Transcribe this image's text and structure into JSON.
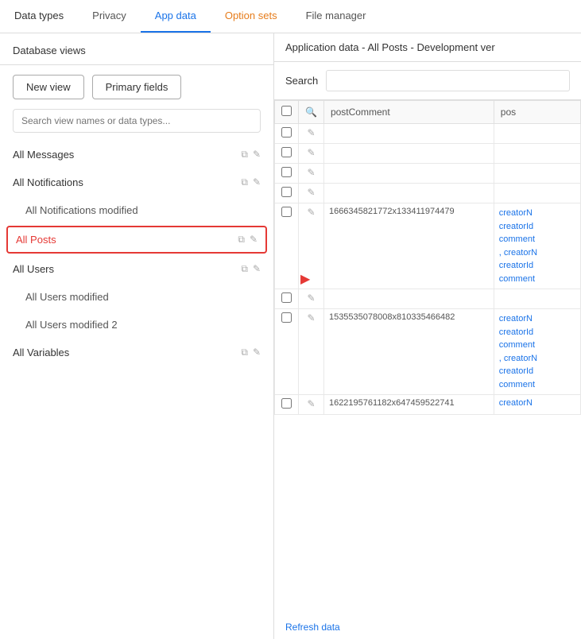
{
  "tabs": [
    {
      "id": "data-types",
      "label": "Data types",
      "active": false,
      "colored": false
    },
    {
      "id": "privacy",
      "label": "Privacy",
      "active": false,
      "colored": false
    },
    {
      "id": "app-data",
      "label": "App data",
      "active": true,
      "colored": false
    },
    {
      "id": "option-sets",
      "label": "Option sets",
      "active": false,
      "colored": true
    },
    {
      "id": "file-manager",
      "label": "File manager",
      "active": false,
      "colored": false
    }
  ],
  "left_panel": {
    "header": "Database views",
    "buttons": {
      "new_view": "New view",
      "primary_fields": "Primary fields"
    },
    "search_placeholder": "Search view names or data types...",
    "nav_items": [
      {
        "id": "all-messages",
        "label": "All Messages",
        "sub": false,
        "selected": false,
        "has_icons": true
      },
      {
        "id": "all-notifications",
        "label": "All Notifications",
        "sub": false,
        "selected": false,
        "has_icons": true
      },
      {
        "id": "all-notifications-modified",
        "label": "All Notifications modified",
        "sub": true,
        "selected": false,
        "has_icons": false
      },
      {
        "id": "all-posts",
        "label": "All Posts",
        "sub": false,
        "selected": true,
        "has_icons": true
      },
      {
        "id": "all-users",
        "label": "All Users",
        "sub": false,
        "selected": false,
        "has_icons": true
      },
      {
        "id": "all-users-modified",
        "label": "All Users modified",
        "sub": true,
        "selected": false,
        "has_icons": false
      },
      {
        "id": "all-users-modified-2",
        "label": "All Users modified 2",
        "sub": true,
        "selected": false,
        "has_icons": false
      },
      {
        "id": "all-variables",
        "label": "All Variables",
        "sub": false,
        "selected": false,
        "has_icons": true
      }
    ]
  },
  "right_panel": {
    "header": "Application data - All Posts - Development ver",
    "search_label": "Search",
    "search_placeholder": "",
    "table": {
      "columns": [
        {
          "id": "check",
          "label": "",
          "type": "check"
        },
        {
          "id": "search",
          "label": "🔍",
          "type": "icon"
        },
        {
          "id": "postComment",
          "label": "postComment",
          "type": "text"
        },
        {
          "id": "pos",
          "label": "pos",
          "type": "text"
        }
      ],
      "rows": [
        {
          "check": false,
          "edit": true,
          "id": "",
          "link": ""
        },
        {
          "check": false,
          "edit": true,
          "id": "",
          "link": ""
        },
        {
          "check": false,
          "edit": true,
          "id": "",
          "link": ""
        },
        {
          "check": false,
          "edit": true,
          "id": "",
          "link": ""
        },
        {
          "check": false,
          "edit": true,
          "id": "1666345821772x133411974479",
          "link": "creatorN\ncreatorId\ncomment\n, creatorN\ncreatorId\ncomment",
          "warning": true
        },
        {
          "check": false,
          "edit": true,
          "id": "",
          "link": ""
        },
        {
          "check": false,
          "edit": true,
          "id": "1535535078008x810335466482",
          "link": "creatorN\ncreatorId\ncomment\n, creatorN\ncreatorId\ncomment",
          "warning": false
        },
        {
          "check": false,
          "edit": true,
          "id": "1622195761182x647459522741",
          "link": "creatorN",
          "warning": false
        }
      ]
    },
    "refresh_label": "Refresh data"
  }
}
